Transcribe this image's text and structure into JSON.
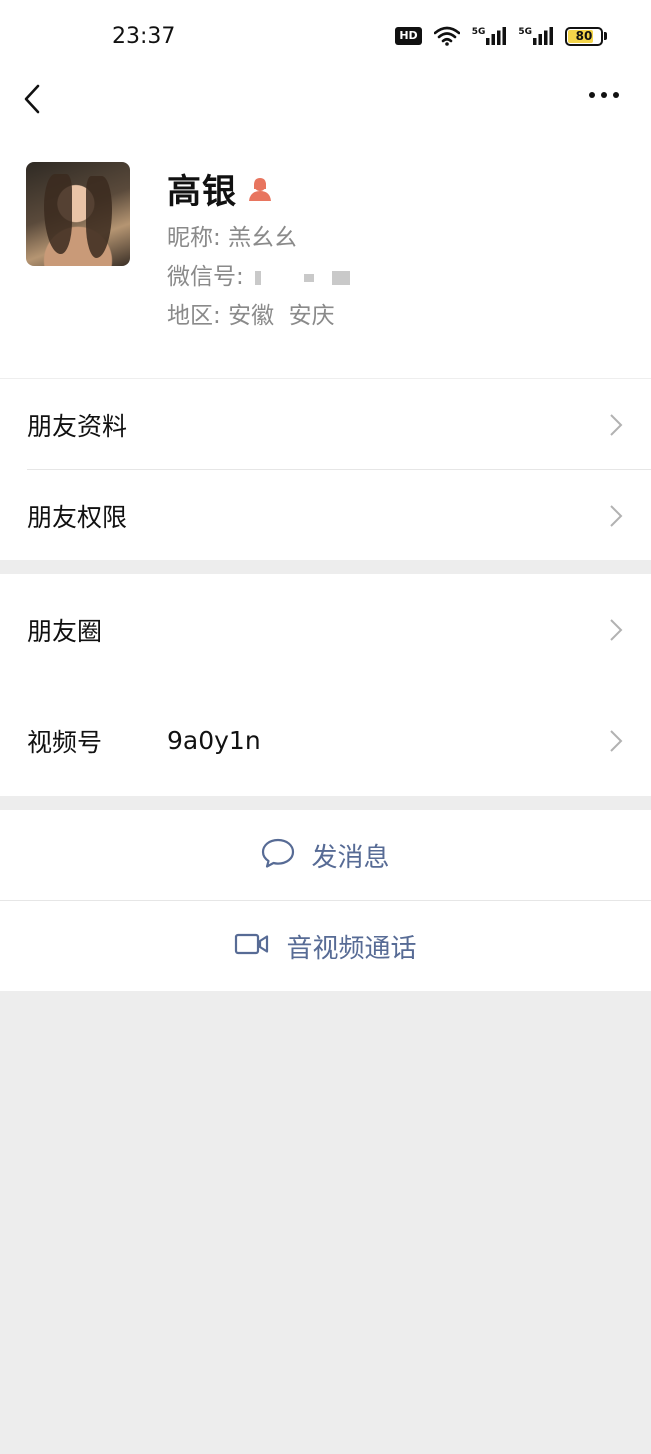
{
  "status_bar": {
    "time": "23:37",
    "hd_label": "HD",
    "network_1": "5G",
    "network_2": "5G",
    "battery": "80",
    "battery_level": 0.8
  },
  "profile": {
    "name": "高银",
    "nickname_label": "昵称:",
    "nickname": "羔幺幺",
    "wechat_id_label": "微信号:",
    "region_label": "地区:",
    "region": "安徽  安庆"
  },
  "menu": {
    "group1": [
      {
        "label": "朋友资料"
      },
      {
        "label": "朋友权限"
      }
    ],
    "group2": [
      {
        "label": "朋友圈",
        "value": ""
      },
      {
        "label": "视频号",
        "value": "9a0y1n"
      }
    ]
  },
  "actions": {
    "message": "发消息",
    "call": "音视频通话"
  },
  "colors": {
    "link": "#576b95",
    "female_badge": "#e8755f",
    "background": "#ededed"
  }
}
